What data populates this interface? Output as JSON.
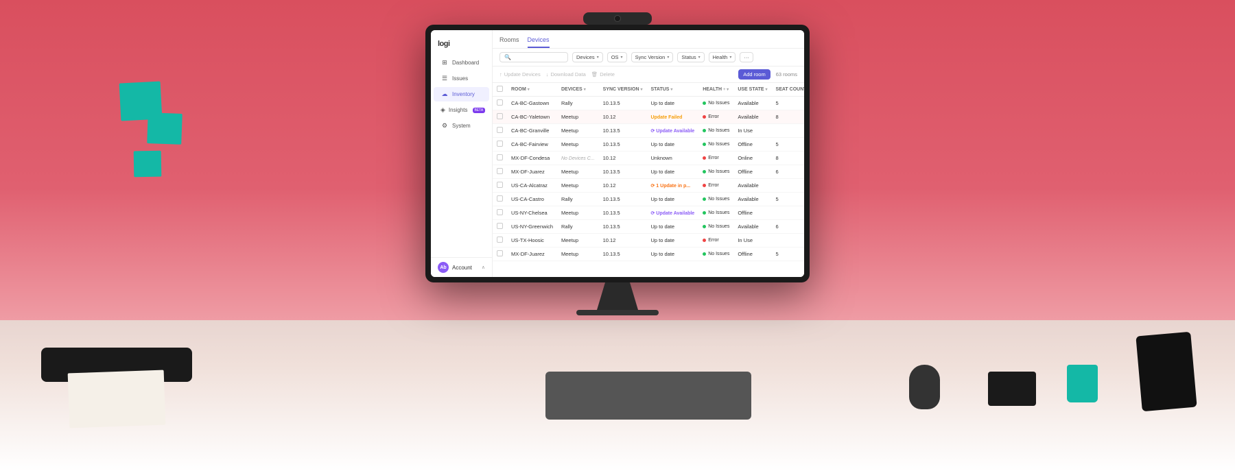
{
  "app": {
    "logo": "logi",
    "nav": [
      {
        "id": "dashboard",
        "label": "Dashboard",
        "icon": "⊞",
        "active": false
      },
      {
        "id": "issues",
        "label": "Issues",
        "icon": "⚠",
        "active": false
      },
      {
        "id": "inventory",
        "label": "Inventory",
        "icon": "☁",
        "active": true
      },
      {
        "id": "insights",
        "label": "Insights",
        "icon": "◈",
        "active": false,
        "badge": "BETA"
      },
      {
        "id": "system",
        "label": "System",
        "icon": "⚙",
        "active": false
      }
    ],
    "account": {
      "initials": "Ab",
      "label": "Account"
    }
  },
  "tabs": [
    {
      "id": "rooms",
      "label": "Rooms",
      "active": false
    },
    {
      "id": "devices",
      "label": "Devices",
      "active": true
    }
  ],
  "filters": [
    {
      "id": "devices",
      "label": "Devices"
    },
    {
      "id": "os",
      "label": "OS"
    },
    {
      "id": "sync-version",
      "label": "Sync Version"
    },
    {
      "id": "status",
      "label": "Status"
    },
    {
      "id": "health",
      "label": "Health"
    },
    {
      "id": "more",
      "label": "···"
    }
  ],
  "search": {
    "placeholder": ""
  },
  "actions": {
    "update_devices": "Update Devices",
    "download_data": "Download Data",
    "delete": "Delete",
    "add_room": "Add room",
    "rooms_count": "63 rooms"
  },
  "table": {
    "columns": [
      {
        "id": "checkbox",
        "label": ""
      },
      {
        "id": "room",
        "label": "ROOM"
      },
      {
        "id": "devices",
        "label": "DEVICES"
      },
      {
        "id": "sync_version",
        "label": "SYNC VERSION"
      },
      {
        "id": "status",
        "label": "STATUS"
      },
      {
        "id": "health",
        "label": "HEALTH"
      },
      {
        "id": "use_state",
        "label": "USE STATE"
      },
      {
        "id": "seat_count",
        "label": "SEAT COUNT"
      }
    ],
    "rows": [
      {
        "room": "CA-BC-Gastown",
        "devices": "Rally",
        "sync_version": "10.13.5",
        "status": "Up to date",
        "status_type": "normal",
        "health": "No Issues",
        "health_dot": "green",
        "use_state": "Available",
        "seat_count": "5"
      },
      {
        "room": "CA-BC-Yaletown",
        "devices": "Meetup",
        "sync_version": "10.12",
        "status": "Update Failed",
        "status_type": "error",
        "health": "Error",
        "health_dot": "red",
        "use_state": "Available",
        "seat_count": "8",
        "highlighted": true
      },
      {
        "room": "CA-BC-Granville",
        "devices": "Meetup",
        "sync_version": "10.13.5",
        "status": "Update Available",
        "status_type": "update",
        "health": "No Issues",
        "health_dot": "green",
        "use_state": "In Use",
        "seat_count": ""
      },
      {
        "room": "CA-BC-Fairview",
        "devices": "Meetup",
        "sync_version": "10.13.5",
        "status": "Up to date",
        "status_type": "normal",
        "health": "No Issues",
        "health_dot": "green",
        "use_state": "Offline",
        "seat_count": "5"
      },
      {
        "room": "MX-DF-Condesa",
        "devices": "No Devices C...",
        "sync_version": "10.12",
        "status": "Unknown",
        "status_type": "normal",
        "health": "Error",
        "health_dot": "red",
        "use_state": "Online",
        "seat_count": "8"
      },
      {
        "room": "MX-DF-Juarez",
        "devices": "Meetup",
        "sync_version": "10.13.5",
        "status": "Up to date",
        "status_type": "normal",
        "health": "No Issues",
        "health_dot": "green",
        "use_state": "Offline",
        "seat_count": "6"
      },
      {
        "room": "US-CA-Alcatraz",
        "devices": "Meetup",
        "sync_version": "10.12",
        "status": "1 Update in p...",
        "status_type": "update-orange",
        "health": "Error",
        "health_dot": "red",
        "use_state": "Available",
        "seat_count": ""
      },
      {
        "room": "US-CA-Castro",
        "devices": "Rally",
        "sync_version": "10.13.5",
        "status": "Up to date",
        "status_type": "normal",
        "health": "No Issues",
        "health_dot": "green",
        "use_state": "Available",
        "seat_count": "5"
      },
      {
        "room": "US-NY-Chelsea",
        "devices": "Meetup",
        "sync_version": "10.13.5",
        "status": "Update Available",
        "status_type": "update",
        "health": "No Issues",
        "health_dot": "green",
        "use_state": "Offline",
        "seat_count": ""
      },
      {
        "room": "US-NY-Greenwich",
        "devices": "Rally",
        "sync_version": "10.13.5",
        "status": "Up to date",
        "status_type": "normal",
        "health": "No Issues",
        "health_dot": "green",
        "use_state": "Available",
        "seat_count": "6"
      },
      {
        "room": "US-TX-Hoosic",
        "devices": "Meetup",
        "sync_version": "10.12",
        "status": "Up to date",
        "status_type": "normal",
        "health": "Error",
        "health_dot": "red",
        "use_state": "In Use",
        "seat_count": ""
      },
      {
        "room": "MX-DF-Juarez",
        "devices": "Meetup",
        "sync_version": "10.13.5",
        "status": "Up to date",
        "status_type": "normal",
        "health": "No Issues",
        "health_dot": "green",
        "use_state": "Offline",
        "seat_count": "5"
      }
    ]
  }
}
